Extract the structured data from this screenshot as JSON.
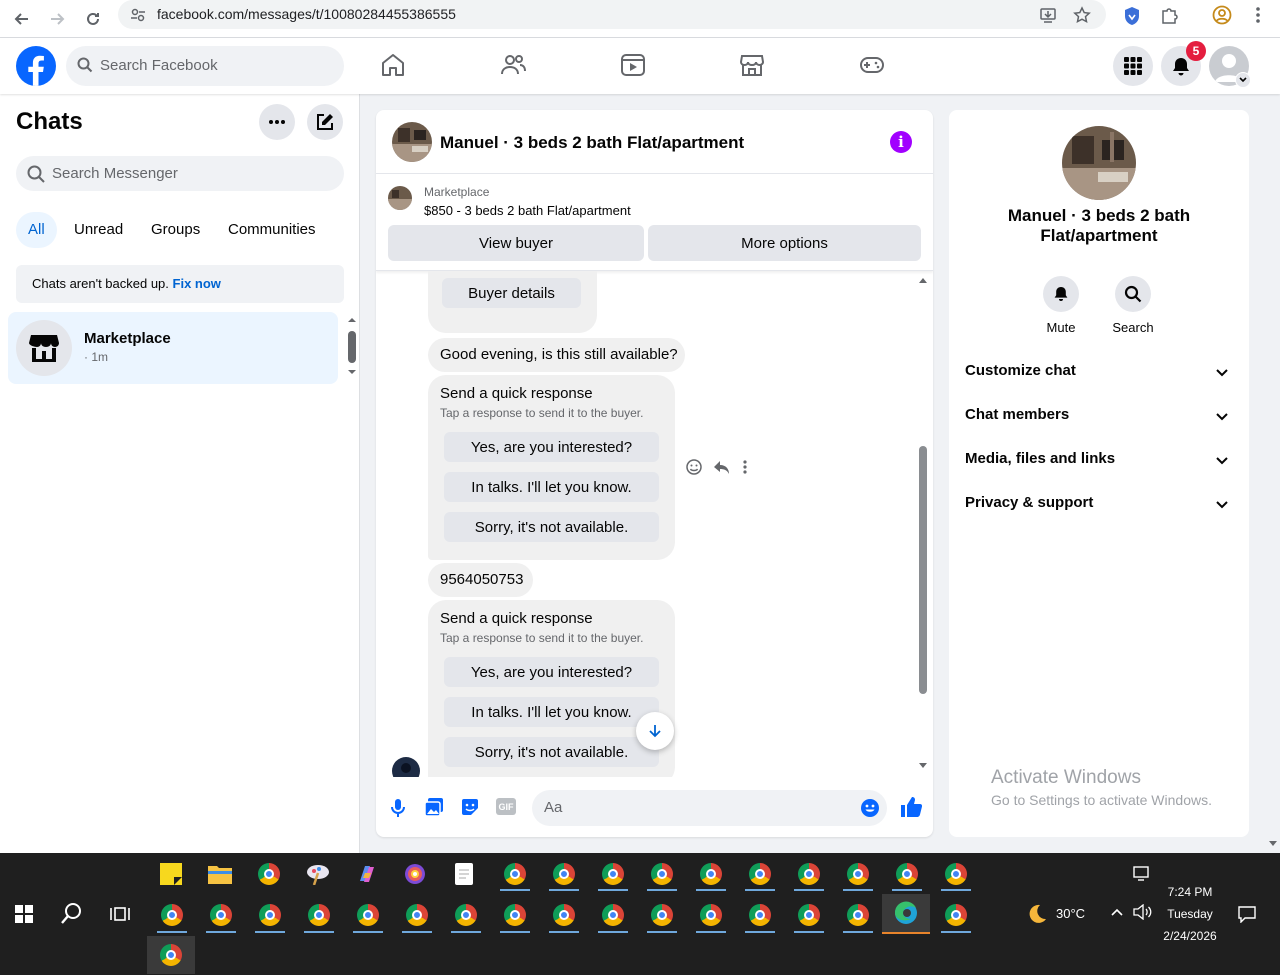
{
  "browser": {
    "url": "facebook.com/messages/t/10080284455386555"
  },
  "header": {
    "search_placeholder": "Search Facebook",
    "notification_count": "5",
    "brand_color": "#0866ff"
  },
  "sidebar": {
    "title": "Chats",
    "search_placeholder": "Search Messenger",
    "filters": [
      "All",
      "Unread",
      "Groups",
      "Communities"
    ],
    "backup_note": "Chats aren't backed up.",
    "backup_fix": "Fix now",
    "chats": [
      {
        "name": "Marketplace",
        "time": "· 1m"
      }
    ]
  },
  "conversation": {
    "title": "Manuel · 3 beds 2 bath Flat/apartment",
    "listing_label": "Marketplace",
    "listing_price": "$850 - 3 beds 2 bath Flat/apartment",
    "view_buyer": "View buyer",
    "more_options": "More options",
    "buyer_details": "Buyer details",
    "messages": [
      {
        "text": "Good evening, is this still available?"
      },
      {
        "text": "9564050753"
      }
    ],
    "quick_response": {
      "title": "Send a quick response",
      "subtitle": "Tap a response to send it to the buyer.",
      "options": [
        "Yes, are you interested?",
        "In talks. I'll let you know.",
        "Sorry, it's not available."
      ]
    },
    "composer_placeholder": "Aa"
  },
  "info_panel": {
    "name": "Manuel · 3 beds 2 bath Flat/apartment",
    "actions": [
      "Mute",
      "Search"
    ],
    "sections": [
      "Customize chat",
      "Chat members",
      "Media, files and links",
      "Privacy & support"
    ]
  },
  "watermark": {
    "line1": "Activate Windows",
    "line2": "Go to Settings to activate Windows."
  },
  "taskbar": {
    "temperature": "30°C",
    "time": "7:24 PM",
    "day": "Tuesday",
    "date": "2/24/2026"
  }
}
